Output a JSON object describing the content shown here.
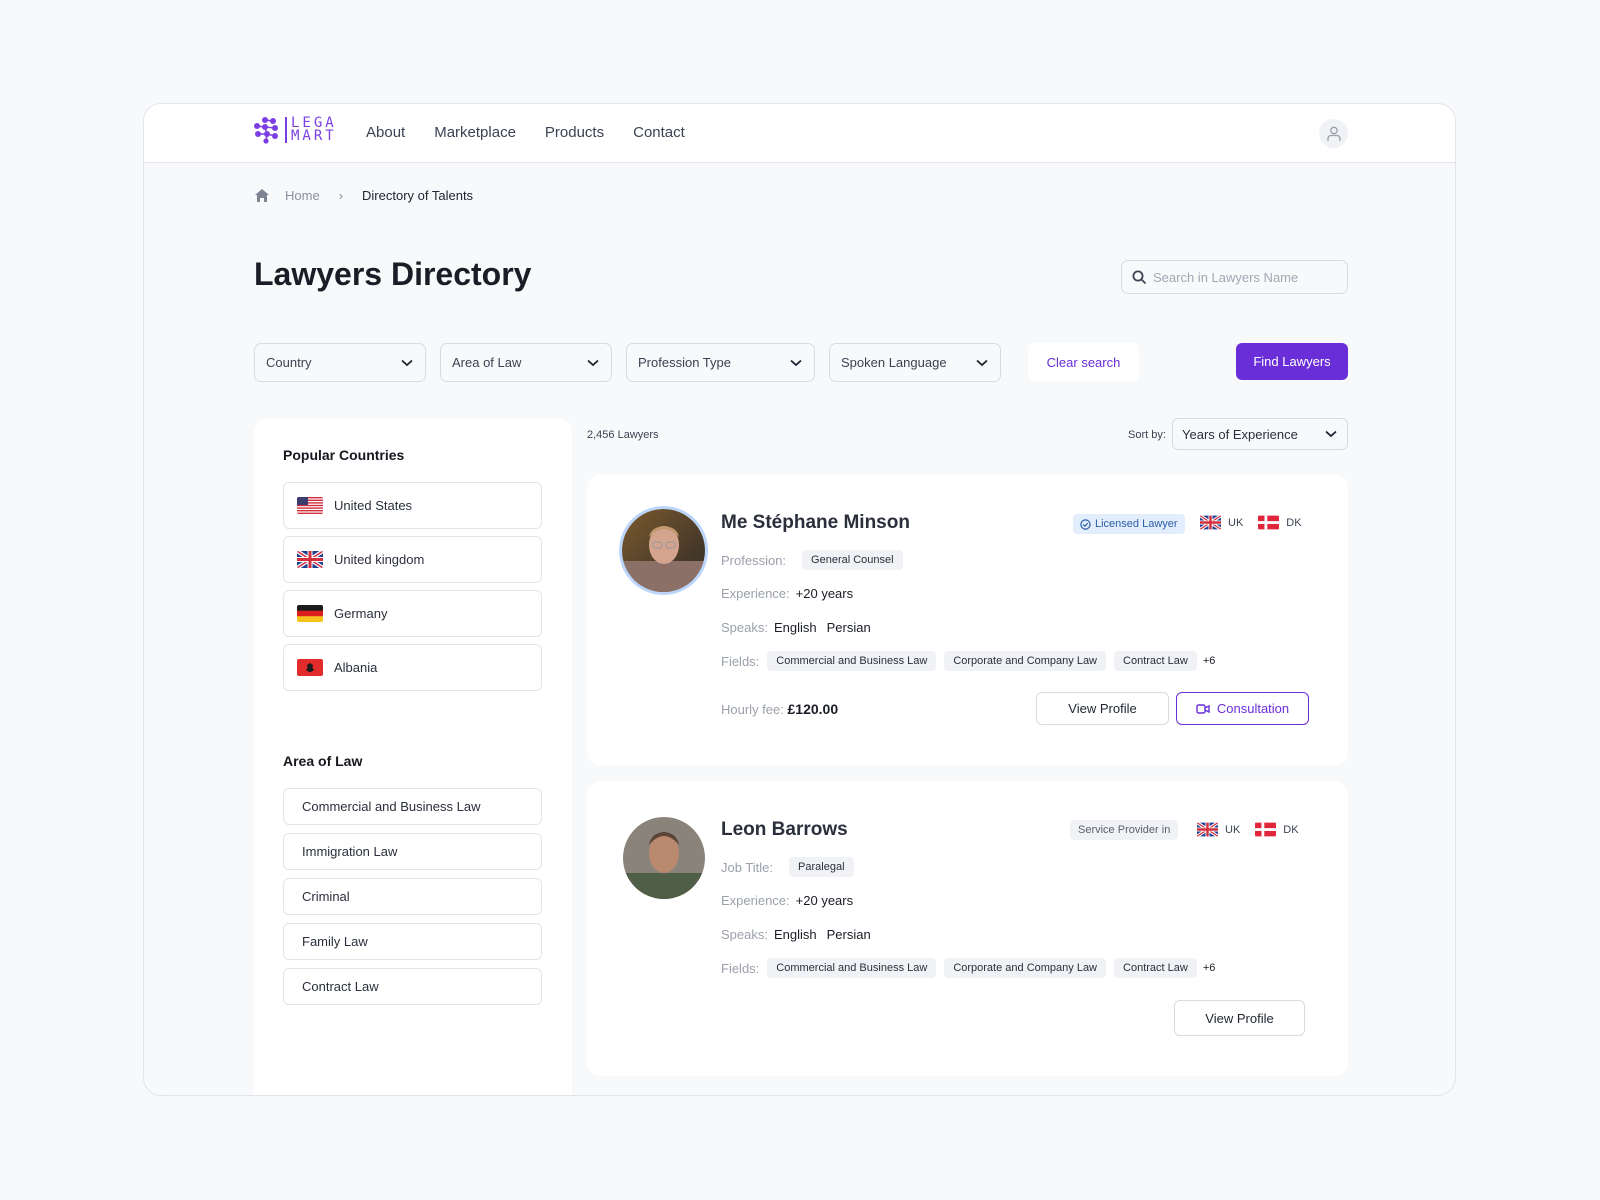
{
  "header": {
    "logo_line1": "LEGA",
    "logo_line2": "MART",
    "nav": [
      "About",
      "Marketplace",
      "Products",
      "Contact"
    ]
  },
  "breadcrumb": {
    "home": "Home",
    "current": "Directory of Talents"
  },
  "page_title": "Lawyers Directory",
  "search": {
    "placeholder": "Search in Lawyers Name",
    "value": ""
  },
  "filters": {
    "selects": [
      "Country",
      "Area of Law",
      "Profession Type",
      "Spoken Language"
    ],
    "clear_label": "Clear search",
    "find_label": "Find Lawyers"
  },
  "sidebar": {
    "popular_title": "Popular Countries",
    "countries": [
      {
        "name": "United States",
        "flag": "us"
      },
      {
        "name": "United kingdom",
        "flag": "uk"
      },
      {
        "name": "Germany",
        "flag": "de"
      },
      {
        "name": "Albania",
        "flag": "al"
      }
    ],
    "law_title": "Area of Law",
    "areas": [
      "Commercial and Business Law",
      "Immigration Law",
      "Criminal",
      "Family Law",
      "Contract Law"
    ]
  },
  "results": {
    "count": "2,456 Lawyers",
    "sort_label": "Sort by:",
    "sort_value": "Years of Experience"
  },
  "lawyers": [
    {
      "name": "Me Stéphane Minson",
      "badge": "Licensed Lawyer",
      "countries": [
        "UK",
        "DK"
      ],
      "role_label": "Profession:",
      "role": "General Counsel",
      "exp_label": "Experience:",
      "experience": "+20 years",
      "speaks_label": "Speaks:",
      "languages": [
        "English",
        "Persian"
      ],
      "fields_label": "Fields:",
      "fields": [
        "Commercial and Business Law",
        "Corporate and Company Law",
        "Contract Law"
      ],
      "more_fields": "+6",
      "fee_label": "Hourly fee:",
      "fee": "£120.00",
      "view_label": "View Profile",
      "consult_label": "Consultation"
    },
    {
      "name": "Leon Barrows",
      "badge": "Service Provider in",
      "countries": [
        "UK",
        "DK"
      ],
      "role_label": "Job Title:",
      "role": "Paralegal",
      "exp_label": "Experience:",
      "experience": "+20 years",
      "speaks_label": "Speaks:",
      "languages": [
        "English",
        "Persian"
      ],
      "fields_label": "Fields:",
      "fields": [
        "Commercial and Business Law",
        "Corporate and Company Law",
        "Contract Law"
      ],
      "more_fields": "+6",
      "view_label": "View Profile"
    }
  ],
  "colors": {
    "accent": "#6a2ed8",
    "licensed_badge_bg": "#e3eefc"
  }
}
